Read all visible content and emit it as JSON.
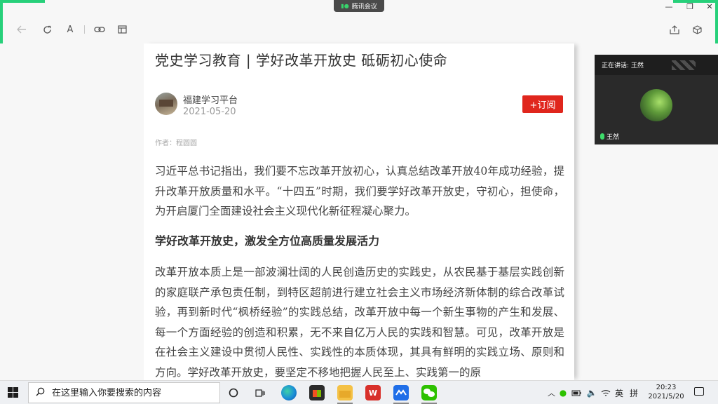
{
  "meeting": {
    "label": "腾讯会议"
  },
  "article": {
    "title": "党史学习教育 | 学好改革开放史 砥砺初心使命",
    "account": "福建学习平台",
    "date": "2021-05-20",
    "subscribe_label": "+订阅",
    "author": "作者：程圆圆",
    "paragraph1": "习近平总书记指出，我们要不忘改革开放初心，认真总结改革开放40年成功经验，提升改革开放质量和水平。“十四五”时期，我们要学好改革开放史，守初心，担使命，为开启厦门全面建设社会主义现代化新征程凝心聚力。",
    "subheading": "学好改革开放史，激发全方位高质量发展活力",
    "paragraph2": "改革开放本质上是一部波澜壮阔的人民创造历史的实践史，从农民基于基层实践创新的家庭联产承包责任制，到特区超前进行建立社会主义市场经济新体制的综合改革试验，再到新时代“枫桥经验”的实践总结，改革开放中每一个新生事物的产生和发展、每一个方面经验的创造和积累，无不来自亿万人民的实践和智慧。可见，改革开放是在社会主义建设中贯彻人民性、实践性的本质体现，其具有鲜明的实践立场、原则和方向。学好改革开放史，要坚定不移地把握人民至上、实践第一的原"
  },
  "video": {
    "speaking_label": "正在讲话: 王然",
    "participant_name": "王然"
  },
  "taskbar": {
    "search_placeholder": "在这里输入你要搜索的内容",
    "ime_lang": "英",
    "ime_mode": "拼",
    "time": "20:23",
    "date": "2021/5/20"
  }
}
